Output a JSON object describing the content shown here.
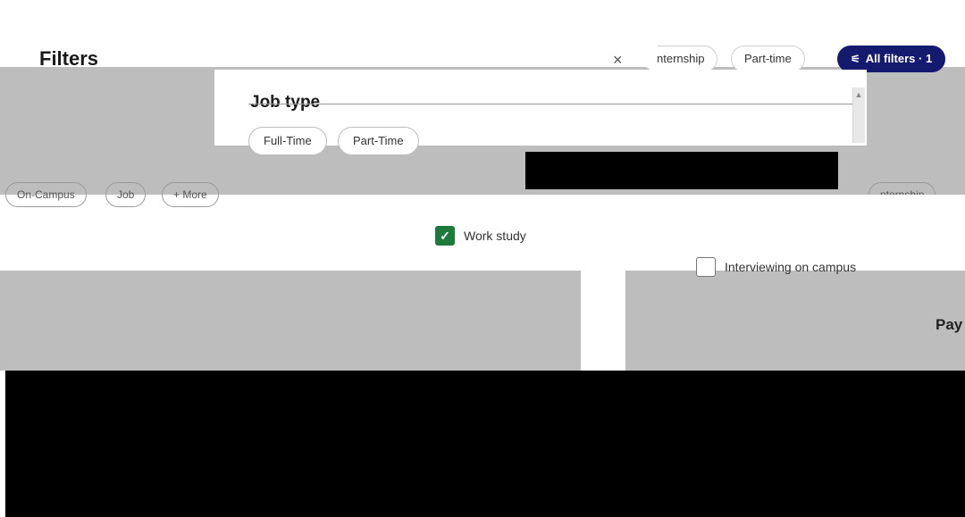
{
  "modal": {
    "title": "Filters",
    "close_glyph": "×",
    "section_title": "Job type",
    "job_type_options": [
      "Full-Time",
      "Part-Time"
    ],
    "checkboxes": [
      {
        "label": "Work study",
        "checked": true
      },
      {
        "label": "Interviewing on campus",
        "checked": false
      }
    ]
  },
  "topbar": {
    "chips": [
      "nternship",
      "Part-time"
    ],
    "all_filters_label": "All filters · 1",
    "filter_icon": "filter-sliders-icon"
  },
  "background": {
    "chips_row": [
      "On-Campus",
      "Job",
      "+ More"
    ],
    "right_chip": "nternship",
    "pay_label": "Pay"
  },
  "colors": {
    "primary": "#141a6e",
    "checkbox_checked": "#1e7a3a",
    "overlay_gray": "#bdbdbd",
    "redaction": "#000000"
  }
}
